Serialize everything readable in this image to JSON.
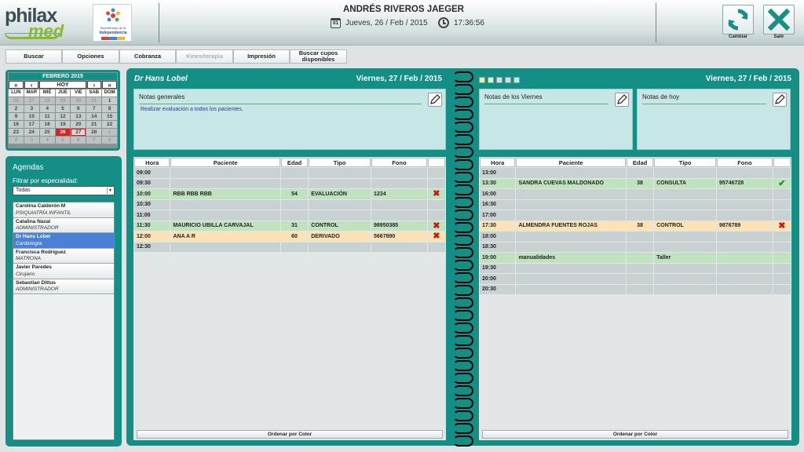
{
  "header": {
    "logo_text_1": "philax",
    "logo_text_2": "med",
    "partner_logo_line1": "Bicentenario de la",
    "partner_logo_line2": "Independencia",
    "patient_name": "ANDRÉS RIVEROS JAEGER",
    "date_icon_label": "01",
    "date": "Jueves, 26 / Feb / 2015",
    "time": "17:36:56",
    "change_label": "Cambiar",
    "exit_label": "Salir"
  },
  "toolbar": {
    "buttons": [
      "Buscar",
      "Opciones",
      "Cobranza",
      "Kinesiterapia",
      "Impresión",
      "Buscar cupos disponibles"
    ]
  },
  "calendar": {
    "title": "FEBRERO 2015",
    "nav": [
      "«",
      "‹",
      "HOY",
      "›",
      "»"
    ],
    "weekdays": [
      "LUN",
      "MAR",
      "MIÉ",
      "JUE",
      "VIE",
      "SAB",
      "DOM"
    ],
    "days": [
      "26",
      "27",
      "28",
      "29",
      "30",
      "31",
      "1",
      "2",
      "3",
      "4",
      "5",
      "6",
      "7",
      "8",
      "9",
      "10",
      "11",
      "12",
      "13",
      "14",
      "15",
      "16",
      "17",
      "18",
      "19",
      "20",
      "21",
      "22",
      "23",
      "24",
      "25",
      "26",
      "27",
      "28",
      "1",
      "2",
      "3",
      "4",
      "5",
      "6",
      "7",
      "8"
    ],
    "today": "26",
    "selected": "27"
  },
  "agendas": {
    "title": "Agendas",
    "filter_label": "Filtrar por especialidad:",
    "filter_value": "Todas",
    "items": [
      {
        "name": "Carolina Calderón M",
        "specialty": "PSIQUIATRÍA INFANTIL"
      },
      {
        "name": "Catalina Nazal",
        "specialty": "ADMINISTRADOR"
      },
      {
        "name": "Dr Hans Lobel",
        "specialty": "Cardiología"
      },
      {
        "name": "Francisca Rodriguez",
        "specialty": "MATRONA"
      },
      {
        "name": "Javier Paredes",
        "specialty": "Cirujano"
      },
      {
        "name": "Sebastian Dittus",
        "specialty": "ADMINISTRADOR"
      }
    ]
  },
  "left_page": {
    "doctor": "Dr Hans Lobel",
    "date": "Viernes, 27 / Feb / 2015",
    "notes_title": "Notas generales",
    "notes_text": "Realizar evaluación a todos los pacientes.",
    "columns": [
      "Hora",
      "Paciente",
      "Edad",
      "Tipo",
      "Fono",
      ""
    ],
    "rows": [
      {
        "hora": "09:00",
        "paciente": "",
        "edad": "",
        "tipo": "",
        "fono": "",
        "status": "",
        "color": ""
      },
      {
        "hora": "09:30",
        "paciente": "",
        "edad": "",
        "tipo": "",
        "fono": "",
        "status": "",
        "color": ""
      },
      {
        "hora": "10:00",
        "paciente": "RBB RBB RBB",
        "edad": "54",
        "tipo": "EVALUACIÓN",
        "fono": "1234",
        "status": "✖",
        "color": "g"
      },
      {
        "hora": "10:30",
        "paciente": "",
        "edad": "",
        "tipo": "",
        "fono": "",
        "status": "",
        "color": ""
      },
      {
        "hora": "11:00",
        "paciente": "",
        "edad": "",
        "tipo": "",
        "fono": "",
        "status": "",
        "color": ""
      },
      {
        "hora": "11:30",
        "paciente": "MAURICIO UBILLA CARVAJAL",
        "edad": "31",
        "tipo": "CONTROL",
        "fono": "98950385",
        "status": "✖",
        "color": "g"
      },
      {
        "hora": "12:00",
        "paciente": "ANA A R",
        "edad": "60",
        "tipo": "DERIVADO",
        "fono": "5667890",
        "status": "✖",
        "color": "y"
      },
      {
        "hora": "12:30",
        "paciente": "",
        "edad": "",
        "tipo": "",
        "fono": "",
        "status": "",
        "color": ""
      }
    ],
    "order_label": "Ordenar por Color"
  },
  "right_page": {
    "date": "Viernes, 27 / Feb / 2015",
    "swatch_colors": [
      "#fbe3b6",
      "#e8f0c0",
      "#f4d4d4",
      "#d8d8f0",
      "#c8e8f0"
    ],
    "notes_friday_title": "Notas de los Viernes",
    "notes_today_title": "Notas de hoy",
    "columns": [
      "Hora",
      "Paciente",
      "Edad",
      "Tipo",
      "Fono",
      ""
    ],
    "rows": [
      {
        "hora": "13:00",
        "paciente": "",
        "edad": "",
        "tipo": "",
        "fono": "",
        "status": "",
        "color": ""
      },
      {
        "hora": "13:30",
        "paciente": "SANDRA CUEVAS MALDONADO",
        "edad": "38",
        "tipo": "CONSULTA",
        "fono": "95746728",
        "status": "✔",
        "color": "g"
      },
      {
        "hora": "16:00",
        "paciente": "",
        "edad": "",
        "tipo": "",
        "fono": "",
        "status": "",
        "color": ""
      },
      {
        "hora": "16:30",
        "paciente": "",
        "edad": "",
        "tipo": "",
        "fono": "",
        "status": "",
        "color": ""
      },
      {
        "hora": "17:00",
        "paciente": "",
        "edad": "",
        "tipo": "",
        "fono": "",
        "status": "",
        "color": ""
      },
      {
        "hora": "17:30",
        "paciente": "ALMENDRA FUENTES ROJAS",
        "edad": "38",
        "tipo": "CONTROL",
        "fono": "9876789",
        "status": "✖",
        "color": "y"
      },
      {
        "hora": "18:00",
        "paciente": "",
        "edad": "",
        "tipo": "",
        "fono": "",
        "status": "",
        "color": ""
      },
      {
        "hora": "18:30",
        "paciente": "",
        "edad": "",
        "tipo": "",
        "fono": "",
        "status": "",
        "color": ""
      },
      {
        "hora": "19:00",
        "paciente": "manualidades",
        "edad": "",
        "tipo": "Taller",
        "fono": "",
        "status": "",
        "color": "g"
      },
      {
        "hora": "19:30",
        "paciente": "",
        "edad": "",
        "tipo": "",
        "fono": "",
        "status": "",
        "color": ""
      },
      {
        "hora": "20:00",
        "paciente": "",
        "edad": "",
        "tipo": "",
        "fono": "",
        "status": "",
        "color": ""
      },
      {
        "hora": "20:30",
        "paciente": "",
        "edad": "",
        "tipo": "",
        "fono": "",
        "status": "",
        "color": ""
      }
    ],
    "order_label": "Ordenar por Color"
  }
}
